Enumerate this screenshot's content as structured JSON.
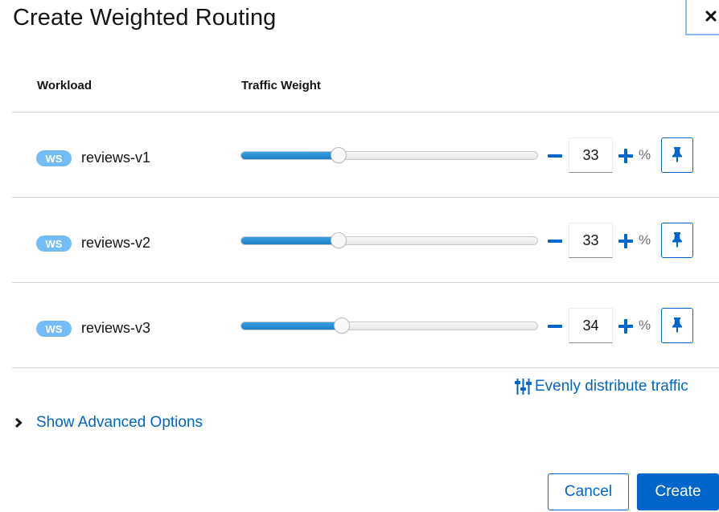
{
  "dialog": {
    "title": "Create Weighted Routing",
    "close_icon": "close-icon"
  },
  "table": {
    "headers": {
      "workload": "Workload",
      "weight": "Traffic Weight"
    },
    "rows": [
      {
        "badge": "WS",
        "name": "reviews-v1",
        "weight": 33,
        "weight_text": "33",
        "unit": "%"
      },
      {
        "badge": "WS",
        "name": "reviews-v2",
        "weight": 33,
        "weight_text": "33",
        "unit": "%"
      },
      {
        "badge": "WS",
        "name": "reviews-v3",
        "weight": 34,
        "weight_text": "34",
        "unit": "%"
      }
    ],
    "icons": {
      "minus": "minus-icon",
      "plus": "plus-icon",
      "pin": "thumbtack-icon"
    }
  },
  "actions": {
    "evenly_distribute": "Evenly distribute traffic",
    "evenly_icon": "sliders-icon",
    "advanced_options": "Show Advanced Options",
    "advanced_icon": "chevron-right-icon",
    "cancel": "Cancel",
    "create": "Create"
  },
  "colors": {
    "accent": "#0066cc",
    "badge": "#73bcf7",
    "slider_fill": "#2b8fd6",
    "close_focus": "#8fb8f5"
  }
}
